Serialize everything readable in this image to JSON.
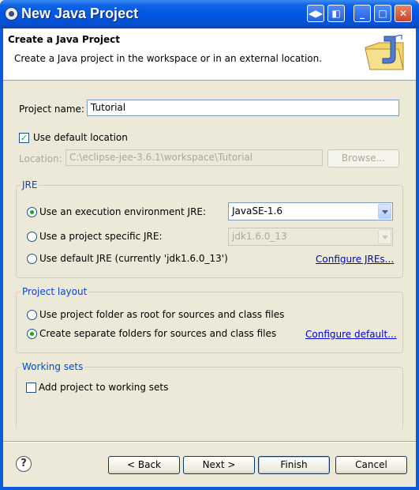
{
  "window": {
    "title": "New Java Project"
  },
  "banner": {
    "title": "Create a Java Project",
    "subtitle": "Create a Java project in the workspace or in an external location."
  },
  "project": {
    "name_label": "Project name:",
    "name_value": "Tutorial"
  },
  "location": {
    "use_default_label": "Use default location",
    "use_default_checked": true,
    "location_label": "Location:",
    "location_value": "C:\\eclipse-jee-3.6.1\\workspace\\Tutorial",
    "browse_label": "Browse..."
  },
  "jre": {
    "group_label": "JRE",
    "option_env_label": "Use an execution environment JRE:",
    "env_value": "JavaSE-1.6",
    "option_specific_label": "Use a project specific JRE:",
    "specific_value": "jdk1.6.0_13",
    "option_default_label": "Use default JRE (currently 'jdk1.6.0_13')",
    "configure_link": "Configure JREs...",
    "selected": "env"
  },
  "layout": {
    "group_label": "Project layout",
    "option_root_label": "Use project folder as root for sources and class files",
    "option_separate_label": "Create separate folders for sources and class files",
    "configure_link": "Configure default...",
    "selected": "separate"
  },
  "working_sets": {
    "group_label": "Working sets",
    "add_label": "Add project to working sets",
    "add_checked": false
  },
  "footer": {
    "back_label": "< Back",
    "next_label": "Next >",
    "finish_label": "Finish",
    "cancel_label": "Cancel"
  },
  "icons": [
    "eclipse-icon",
    "java-project-wizard-icon",
    "help-icon"
  ]
}
